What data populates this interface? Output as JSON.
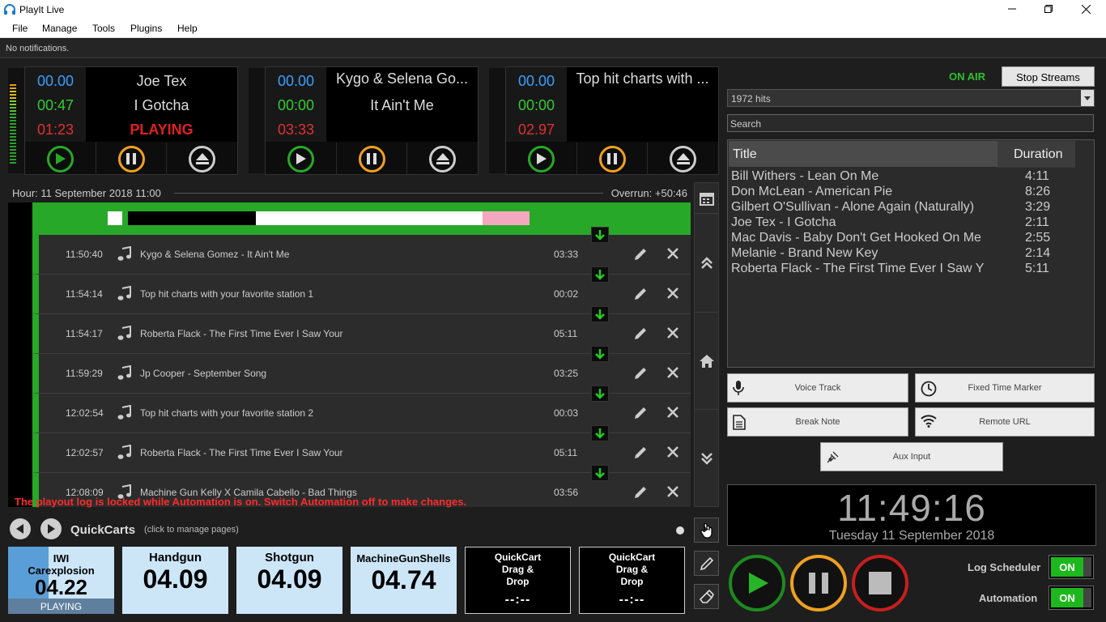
{
  "app": {
    "title": "PlayIt Live"
  },
  "menu": [
    "File",
    "Manage",
    "Tools",
    "Plugins",
    "Help"
  ],
  "notification": "No notifications.",
  "players": [
    {
      "t1": "00.00",
      "t2": "00:47",
      "t3": "01:23",
      "artist": "Joe Tex",
      "song": "I Gotcha",
      "status": "PLAYING"
    },
    {
      "t1": "00.00",
      "t2": "00:00",
      "t3": "03:33",
      "artist": "Kygo & Selena Go...",
      "song": "It Ain't Me",
      "status": ""
    },
    {
      "t1": "00.00",
      "t2": "00:00",
      "t3": "02.97",
      "artist": "Top hit charts with ...",
      "song": "",
      "status": ""
    }
  ],
  "log": {
    "hour": "Hour: 11 September 2018 11:00",
    "overrun": "Overrun: +50:46",
    "rows": [
      {
        "time": "11:50:40",
        "name": "Kygo & Selena Gomez - It Ain't Me",
        "dur": "03:33"
      },
      {
        "time": "11:54:14",
        "name": "Top hit charts with your favorite station 1",
        "dur": "00:02"
      },
      {
        "time": "11:54:17",
        "name": "Roberta Flack - The First Time Ever I Saw Your",
        "dur": "05:11"
      },
      {
        "time": "11:59:29",
        "name": "Jp Cooper - September Song",
        "dur": "03:25"
      },
      {
        "time": "12:02:54",
        "name": "Top hit charts with your favorite station 2",
        "dur": "00:03"
      },
      {
        "time": "12:02:57",
        "name": "Roberta Flack - The First Time Ever I Saw Your",
        "dur": "05:11"
      },
      {
        "time": "12:08:09",
        "name": "Machine Gun Kelly X Camila Cabello - Bad Things",
        "dur": "03:56"
      }
    ],
    "lock_message": "The playout log is locked while Automation is on. Switch Automation off to make changes."
  },
  "quickcarts": {
    "label": "QuickCarts",
    "sub": "(click to manage pages)",
    "carts": [
      {
        "name": "IWI Carexplosion",
        "value": "04.22",
        "status": "PLAYING"
      },
      {
        "name": "Handgun",
        "value": "04.09"
      },
      {
        "name": "Shotgun",
        "value": "04.09"
      },
      {
        "name": "MachineGunShells",
        "value": "04.74"
      },
      {
        "name": "QuickCart Drag & Drop",
        "value": "--:--"
      },
      {
        "name": "QuickCart Drag & Drop",
        "value": "--:--"
      }
    ]
  },
  "right": {
    "on_air": "ON AIR",
    "stop_streams": "Stop Streams",
    "playlist": "1972 hits",
    "search_placeholder": "Search",
    "col_title": "Title",
    "col_duration": "Duration",
    "tracks": [
      {
        "title": "Bill Withers - Lean On Me",
        "dur": "4:11"
      },
      {
        "title": "Don McLean - American Pie",
        "dur": "8:26"
      },
      {
        "title": "Gilbert O'Sullivan - Alone Again (Naturally)",
        "dur": "3:29"
      },
      {
        "title": "Joe Tex - I Gotcha",
        "dur": "2:11"
      },
      {
        "title": "Mac Davis - Baby Don't Get Hooked On Me",
        "dur": "2:55"
      },
      {
        "title": "Melanie - Brand New Key",
        "dur": "2:14"
      },
      {
        "title": "Roberta Flack - The First Time Ever I Saw Y",
        "dur": "5:11"
      }
    ],
    "buttons": {
      "voice_track": "Voice Track",
      "fixed_time": "Fixed Time Marker",
      "break_note": "Break Note",
      "remote_url": "Remote URL",
      "aux_input": "Aux Input"
    },
    "clock": "11:49:16",
    "date": "Tuesday 11 September 2018",
    "log_scheduler": "Log Scheduler",
    "automation": "Automation",
    "on": "ON"
  },
  "colors": {
    "green": "#28a828",
    "orange": "#f0a020",
    "red": "#e02020",
    "time_blue": "#3aa0ff",
    "time_green": "#33cc33",
    "time_red": "#e03030"
  }
}
